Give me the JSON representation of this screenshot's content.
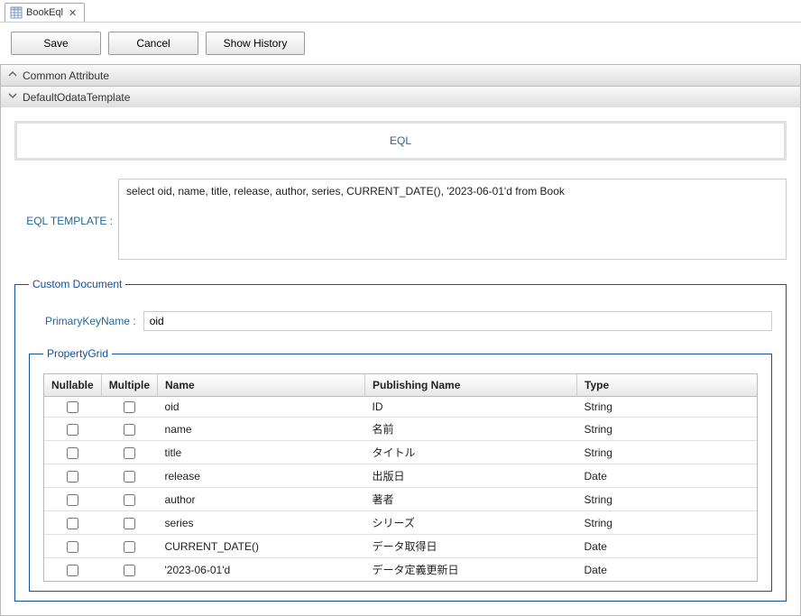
{
  "tab": {
    "label": "BookEql"
  },
  "toolbar": {
    "save": "Save",
    "cancel": "Cancel",
    "history": "Show History"
  },
  "sections": {
    "commonAttr": "Common Attribute",
    "defaultTpl": "DefaultOdataTemplate"
  },
  "eql": {
    "heading": "EQL",
    "templateLabel": "EQL TEMPLATE :",
    "templateValue": "select oid, name, title, release, author, series, CURRENT_DATE(), '2023-06-01'd from Book"
  },
  "customDoc": {
    "legend": "Custom Document",
    "pkLabel": "PrimaryKeyName :",
    "pkValue": "oid"
  },
  "grid": {
    "legend": "PropertyGrid",
    "headers": {
      "nullable": "Nullable",
      "multiple": "Multiple",
      "name": "Name",
      "pub": "Publishing Name",
      "type": "Type"
    },
    "rows": [
      {
        "name": "oid",
        "pub": "ID",
        "type": "String"
      },
      {
        "name": "name",
        "pub": "名前",
        "type": "String"
      },
      {
        "name": "title",
        "pub": "タイトル",
        "type": "String"
      },
      {
        "name": "release",
        "pub": "出版日",
        "type": "Date"
      },
      {
        "name": "author",
        "pub": "著者",
        "type": "String"
      },
      {
        "name": "series",
        "pub": "シリーズ",
        "type": "String"
      },
      {
        "name": "CURRENT_DATE()",
        "pub": "データ取得日",
        "type": "Date"
      },
      {
        "name": "'2023-06-01'd",
        "pub": "データ定義更新日",
        "type": "Date"
      }
    ]
  }
}
